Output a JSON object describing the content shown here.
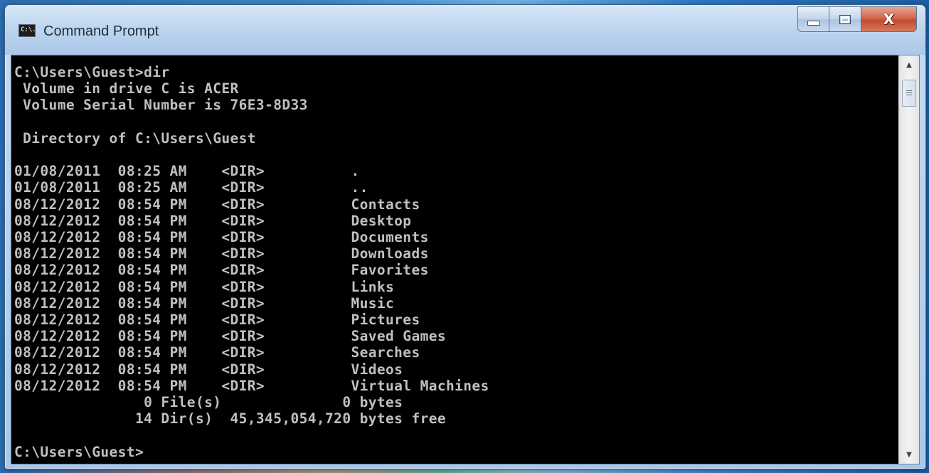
{
  "window": {
    "title": "Command Prompt",
    "icon_text": "C:\\.",
    "controls": {
      "minimize": "minimize",
      "maximize": "maximize",
      "close": "X"
    }
  },
  "console": {
    "lines": [
      "C:\\Users\\Guest>dir",
      " Volume in drive C is ACER",
      " Volume Serial Number is 76E3-8D33",
      "",
      " Directory of C:\\Users\\Guest",
      "",
      "01/08/2011  08:25 AM    <DIR>          .",
      "01/08/2011  08:25 AM    <DIR>          ..",
      "08/12/2012  08:54 PM    <DIR>          Contacts",
      "08/12/2012  08:54 PM    <DIR>          Desktop",
      "08/12/2012  08:54 PM    <DIR>          Documents",
      "08/12/2012  08:54 PM    <DIR>          Downloads",
      "08/12/2012  08:54 PM    <DIR>          Favorites",
      "08/12/2012  08:54 PM    <DIR>          Links",
      "08/12/2012  08:54 PM    <DIR>          Music",
      "08/12/2012  08:54 PM    <DIR>          Pictures",
      "08/12/2012  08:54 PM    <DIR>          Saved Games",
      "08/12/2012  08:54 PM    <DIR>          Searches",
      "08/12/2012  08:54 PM    <DIR>          Videos",
      "08/12/2012  08:54 PM    <DIR>          Virtual Machines",
      "               0 File(s)              0 bytes",
      "              14 Dir(s)  45,345,054,720 bytes free",
      "",
      "C:\\Users\\Guest>"
    ]
  },
  "colors": {
    "console_background": "#000000",
    "console_text": "#c0c0c0",
    "close_button": "#c9563b",
    "titlebar": "#bed6ef"
  },
  "icons": {
    "app": "cmd-icon",
    "minimize": "minimize-icon",
    "maximize": "maximize-icon",
    "close": "close-icon",
    "scroll_up": "arrow-up-icon",
    "scroll_down": "arrow-down-icon",
    "scroll_grip": "grip-icon"
  }
}
